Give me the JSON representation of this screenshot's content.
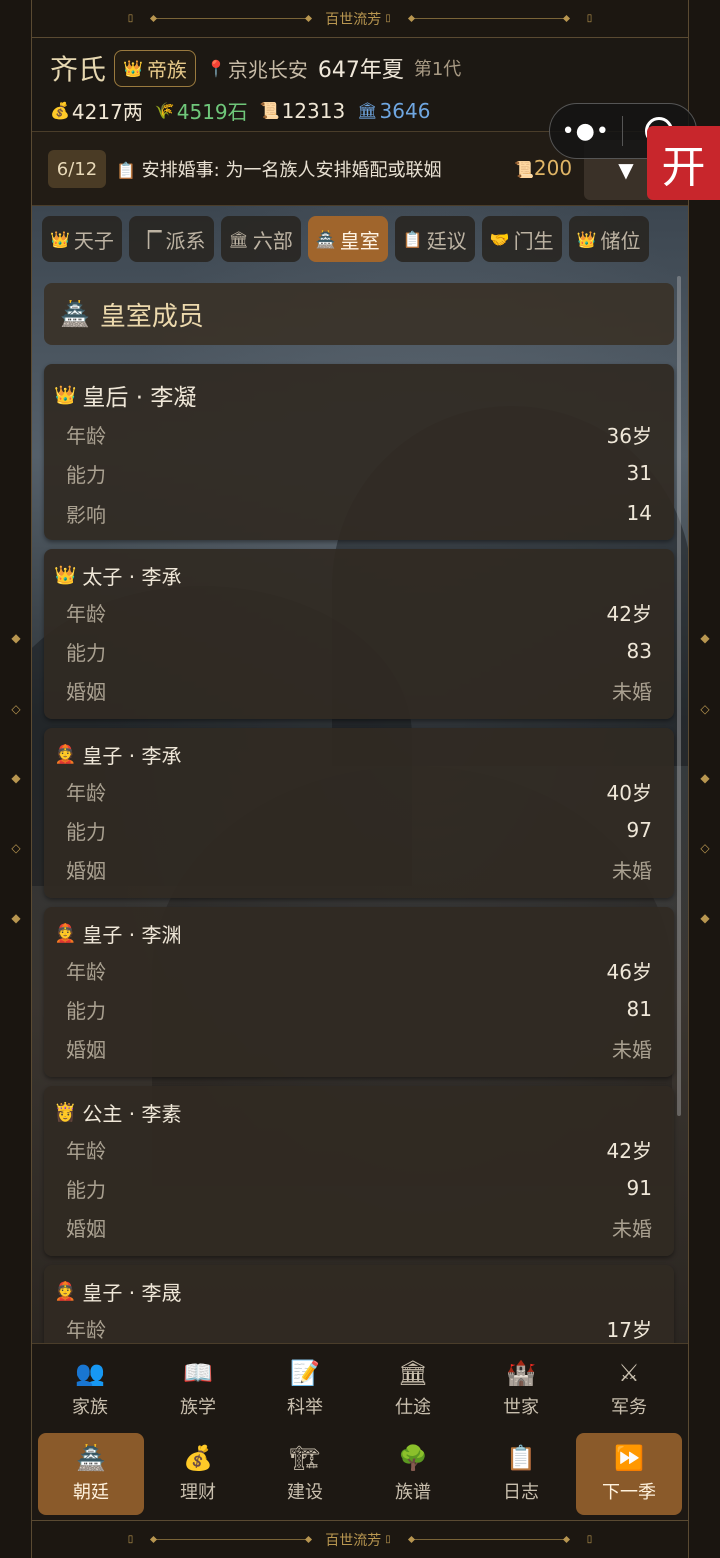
{
  "frame": {
    "title": "百世流芳"
  },
  "header": {
    "clan_name": "齐氏",
    "rank": "帝族",
    "location": "京兆长安",
    "year": "647年夏",
    "generation": "第1代",
    "resources": {
      "silver": "4217两",
      "grain": "4519石",
      "scrolls": "12313",
      "prestige": "3646"
    }
  },
  "miniprogram": {
    "open_label": "开"
  },
  "task": {
    "count": "6/12",
    "text": "安排婚事: 为一名族人安排婚配或联姻",
    "cost": "200",
    "toggle": "▼"
  },
  "tabs": [
    {
      "label": "天子",
      "icon": "crown-icon"
    },
    {
      "label": "派系",
      "icon": "flag-icon"
    },
    {
      "label": "六部",
      "icon": "bank-icon"
    },
    {
      "label": "皇室",
      "icon": "palace-icon",
      "active": true
    },
    {
      "label": "廷议",
      "icon": "clipboard-icon"
    },
    {
      "label": "门生",
      "icon": "handshake-icon"
    },
    {
      "label": "储位",
      "icon": "crown-icon"
    }
  ],
  "section": {
    "title": "皇室成员"
  },
  "stat_labels": {
    "age": "年龄",
    "ability": "能力",
    "influence": "影响",
    "marriage": "婚姻"
  },
  "members": [
    {
      "title": "皇后 · 李凝",
      "icon": "crown-icon",
      "age": "36岁",
      "ability": "31",
      "third_label": "影响",
      "third": "14"
    },
    {
      "title": "太子 · 李承",
      "icon": "crown-icon",
      "age": "42岁",
      "ability": "83",
      "third_label": "婚姻",
      "third": "未婚"
    },
    {
      "title": "皇子 · 李承",
      "icon": "prince-icon",
      "age": "40岁",
      "ability": "97",
      "third_label": "婚姻",
      "third": "未婚"
    },
    {
      "title": "皇子 · 李渊",
      "icon": "prince-icon",
      "age": "46岁",
      "ability": "81",
      "third_label": "婚姻",
      "third": "未婚"
    },
    {
      "title": "公主 · 李素",
      "icon": "princess-icon",
      "age": "42岁",
      "ability": "91",
      "third_label": "婚姻",
      "third": "未婚"
    },
    {
      "title": "皇子 · 李晟",
      "icon": "prince-icon",
      "age": "17岁"
    }
  ],
  "nav": {
    "row1": [
      {
        "label": "家族",
        "icon": "people-icon"
      },
      {
        "label": "族学",
        "icon": "book-icon"
      },
      {
        "label": "科举",
        "icon": "memo-icon"
      },
      {
        "label": "仕途",
        "icon": "bank-icon"
      },
      {
        "label": "世家",
        "icon": "castle-icon"
      },
      {
        "label": "军务",
        "icon": "swords-icon"
      }
    ],
    "row2": [
      {
        "label": "朝廷",
        "icon": "palace-icon",
        "active": true
      },
      {
        "label": "理财",
        "icon": "money-bag-icon"
      },
      {
        "label": "建设",
        "icon": "crane-icon"
      },
      {
        "label": "族谱",
        "icon": "tree-icon"
      },
      {
        "label": "日志",
        "icon": "clipboard-icon"
      },
      {
        "label": "下一季",
        "icon": "fast-forward-icon",
        "active": true
      }
    ]
  }
}
